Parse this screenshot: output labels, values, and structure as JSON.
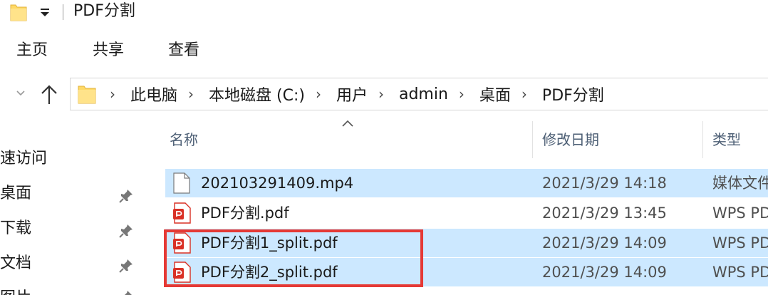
{
  "window": {
    "title": "PDF分割"
  },
  "ribbon": {
    "tabs": [
      "主页",
      "共享",
      "查看"
    ]
  },
  "address": {
    "breadcrumbs": [
      "此电脑",
      "本地磁盘 (C:)",
      "用户",
      "admin",
      "桌面",
      "PDF分割"
    ],
    "separator": "›"
  },
  "navpane": {
    "items": [
      "速访问",
      "桌面",
      "下载",
      "文档",
      "图片"
    ]
  },
  "columns": {
    "name": "名称",
    "modified": "修改日期",
    "type": "类型"
  },
  "files": [
    {
      "name": "202103291409.mp4",
      "modified": "2021/3/29 14:18",
      "type": "媒体文件",
      "icon": "video-file-icon",
      "selected": true
    },
    {
      "name": "PDF分割.pdf",
      "modified": "2021/3/29 13:45",
      "type": "WPS PDF",
      "icon": "pdf-file-icon",
      "selected": false
    },
    {
      "name": "PDF分割1_split.pdf",
      "modified": "2021/3/29 14:09",
      "type": "WPS PDF",
      "icon": "pdf-file-icon",
      "selected": true
    },
    {
      "name": "PDF分割2_split.pdf",
      "modified": "2021/3/29 14:09",
      "type": "WPS PDF",
      "icon": "pdf-file-icon",
      "selected": true
    }
  ],
  "colors": {
    "selection": "#cce8ff",
    "highlight": "#e53935",
    "pdf_red": "#d93025",
    "folder_yellow": "#ffd966",
    "header_text": "#4d5f75"
  }
}
